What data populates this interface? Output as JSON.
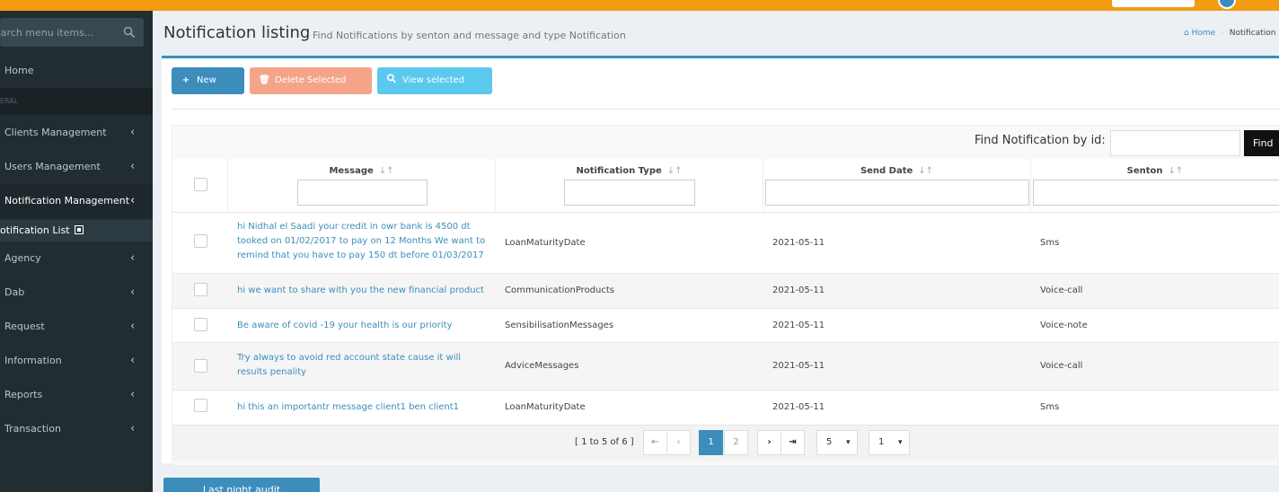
{
  "sidebar": {
    "search_placeholder": "earch menu items...",
    "header": "ERAL",
    "items": [
      {
        "label": "Home"
      },
      {
        "label": "Clients Management"
      },
      {
        "label": "Users Management"
      },
      {
        "label": "Notification Management"
      },
      {
        "label": "Agency"
      },
      {
        "label": "Dab"
      },
      {
        "label": "Request"
      },
      {
        "label": "Information"
      },
      {
        "label": "Reports"
      },
      {
        "label": "Transaction"
      }
    ],
    "sub_item": "otification List"
  },
  "header": {
    "title": "Notification listing",
    "subtitle": "Find Notifications by senton and message and type Notification",
    "breadcrumb_home": "Home",
    "breadcrumb_current": "Notification"
  },
  "toolbar": {
    "new_label": "New",
    "delete_label": "Delete Selected",
    "view_label": "View selected"
  },
  "find": {
    "label": "Find Notification by id:",
    "button": "Find"
  },
  "table": {
    "columns": [
      "Message",
      "Notification Type",
      "Send Date",
      "Senton"
    ],
    "rows": [
      {
        "message": "hi Nidhal el Saadi your credit in owr bank is 4500 dt tooked on 01/02/2017 to pay on 12 Months We want to remind that you have to pay 150 dt before 01/03/2017",
        "type": "LoanMaturityDate",
        "date": "2021-05-11",
        "senton": "Sms"
      },
      {
        "message": "hi we want to share with you the new financial product",
        "type": "CommunicationProducts",
        "date": "2021-05-11",
        "senton": "Voice-call"
      },
      {
        "message": "Be aware of covid -19 your health is our priority",
        "type": "SensibilisationMessages",
        "date": "2021-05-11",
        "senton": "Voice-note"
      },
      {
        "message": "Try always to avoid red account state cause it will results penality",
        "type": "AdviceMessages",
        "date": "2021-05-11",
        "senton": "Voice-call"
      },
      {
        "message": "hi this an importantr message client1 ben client1",
        "type": "LoanMaturityDate",
        "date": "2021-05-11",
        "senton": "Sms"
      }
    ]
  },
  "pager": {
    "summary": "[ 1 to 5 of 6 ]",
    "pages": [
      "1",
      "2"
    ],
    "rows_per_page": "5",
    "page_select": "1"
  },
  "audit_button": "Last night audit",
  "colors": {
    "topbar": "#f39c12",
    "sidebar": "#222d32",
    "primary": "#3c8dbc",
    "danger_light": "#f5a48a",
    "info": "#5bc8ef"
  }
}
